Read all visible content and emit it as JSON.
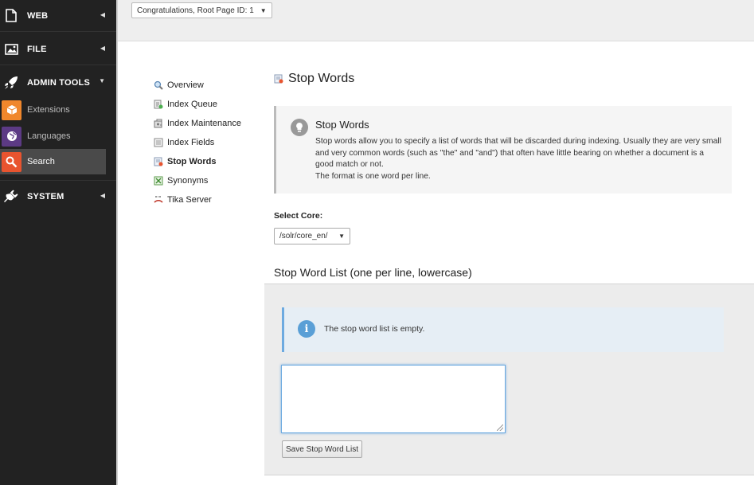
{
  "module_menu": {
    "groups": [
      {
        "label": "WEB",
        "icon": "document-icon"
      },
      {
        "label": "FILE",
        "icon": "image-icon"
      },
      {
        "label": "ADMIN TOOLS",
        "icon": "rocket-icon"
      },
      {
        "label": "SYSTEM",
        "icon": "plug-icon"
      }
    ],
    "admin_items": [
      {
        "label": "Extensions",
        "icon": "box-icon",
        "color": "#f0872c"
      },
      {
        "label": "Languages",
        "icon": "globe-icon",
        "color": "#5c3a84"
      },
      {
        "label": "Search",
        "icon": "search-icon",
        "color": "#e8542f"
      }
    ]
  },
  "docheader": {
    "page_selector": "Congratulations, Root Page ID: 1"
  },
  "subnav": {
    "items": [
      {
        "label": "Overview",
        "icon": "magnifier-icon"
      },
      {
        "label": "Index Queue",
        "icon": "queue-icon"
      },
      {
        "label": "Index Maintenance",
        "icon": "maintenance-icon"
      },
      {
        "label": "Index Fields",
        "icon": "fields-icon"
      },
      {
        "label": "Stop Words",
        "icon": "stopwords-icon"
      },
      {
        "label": "Synonyms",
        "icon": "synonyms-icon"
      },
      {
        "label": "Tika Server",
        "icon": "tika-icon"
      }
    ],
    "active": "Stop Words"
  },
  "content": {
    "title": "Stop Words",
    "info_title": "Stop Words",
    "info_line1": "Stop words allow you to specify a list of words that will be discarded during indexing. Usually they are very small and very common words (such as \"the\" and \"and\") that often have little bearing on whether a document is a good match or not.",
    "info_line2": "The format is one word per line.",
    "select_core_label": "Select Core:",
    "core_value": "/solr/core_en/",
    "list_title": "Stop Word List (one per line, lowercase)",
    "empty_notice": "The stop word list is empty.",
    "textarea_value": "",
    "save_button": "Save Stop Word List"
  },
  "colors": {
    "sidebar_bg": "#222222",
    "notice_accent": "#6daae0"
  }
}
